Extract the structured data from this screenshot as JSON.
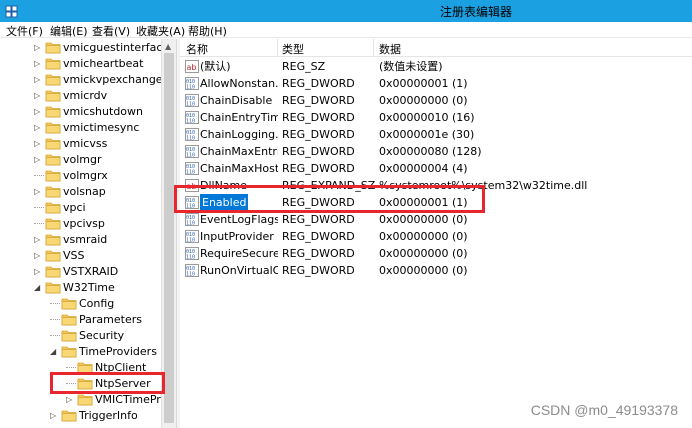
{
  "window": {
    "title": "注册表编辑器",
    "titlebar_color": "#1ba1e2"
  },
  "menu": [
    {
      "label": "文件(F)"
    },
    {
      "label": "编辑(E)"
    },
    {
      "label": "查看(V)"
    },
    {
      "label": "收藏夹(A)"
    },
    {
      "label": "帮助(H)"
    }
  ],
  "tree": {
    "items": [
      {
        "label": "vmicguestinterface",
        "icon": "folder-icon",
        "expander": "collapsed"
      },
      {
        "label": "vmicheartbeat",
        "icon": "folder-icon",
        "expander": "collapsed"
      },
      {
        "label": "vmickvpexchange",
        "icon": "folder-icon",
        "expander": "collapsed"
      },
      {
        "label": "vmicrdv",
        "icon": "folder-icon",
        "expander": "collapsed"
      },
      {
        "label": "vmicshutdown",
        "icon": "folder-icon",
        "expander": "collapsed"
      },
      {
        "label": "vmictimesync",
        "icon": "folder-icon",
        "expander": "collapsed"
      },
      {
        "label": "vmicvss",
        "icon": "folder-icon",
        "expander": "collapsed"
      },
      {
        "label": "volmgr",
        "icon": "folder-icon",
        "expander": "collapsed"
      },
      {
        "label": "volmgrx",
        "icon": "folder-icon",
        "expander": "none"
      },
      {
        "label": "volsnap",
        "icon": "folder-icon",
        "expander": "collapsed"
      },
      {
        "label": "vpci",
        "icon": "folder-icon",
        "expander": "none"
      },
      {
        "label": "vpcivsp",
        "icon": "folder-icon",
        "expander": "none"
      },
      {
        "label": "vsmraid",
        "icon": "folder-icon",
        "expander": "collapsed"
      },
      {
        "label": "VSS",
        "icon": "folder-icon",
        "expander": "collapsed"
      },
      {
        "label": "VSTXRAID",
        "icon": "folder-icon",
        "expander": "collapsed"
      },
      {
        "label": "W32Time",
        "icon": "folder-open-icon",
        "expander": "expanded"
      },
      {
        "label": "Config",
        "icon": "folder-icon",
        "expander": "none"
      },
      {
        "label": "Parameters",
        "icon": "folder-icon",
        "expander": "none"
      },
      {
        "label": "Security",
        "icon": "folder-icon",
        "expander": "none"
      },
      {
        "label": "TimeProviders",
        "icon": "folder-open-icon",
        "expander": "expanded"
      },
      {
        "label": "NtpClient",
        "icon": "folder-icon",
        "expander": "none"
      },
      {
        "label": "NtpServer",
        "icon": "folder-open-icon",
        "expander": "none"
      },
      {
        "label": "VMICTimeProv",
        "icon": "folder-icon",
        "expander": "collapsed"
      },
      {
        "label": "TriggerInfo",
        "icon": "folder-icon",
        "expander": "collapsed"
      }
    ]
  },
  "list": {
    "columns": [
      "名称",
      "类型",
      "数据"
    ],
    "rows": [
      {
        "name": "(默认)",
        "type": "REG_SZ",
        "data": "(数值未设置)",
        "icon": "string-value-icon"
      },
      {
        "name": "AllowNonstan...",
        "type": "REG_DWORD",
        "data": "0x00000001 (1)",
        "icon": "binary-value-icon"
      },
      {
        "name": "ChainDisable",
        "type": "REG_DWORD",
        "data": "0x00000000 (0)",
        "icon": "binary-value-icon"
      },
      {
        "name": "ChainEntryTim...",
        "type": "REG_DWORD",
        "data": "0x00000010 (16)",
        "icon": "binary-value-icon"
      },
      {
        "name": "ChainLogging...",
        "type": "REG_DWORD",
        "data": "0x0000001e (30)",
        "icon": "binary-value-icon"
      },
      {
        "name": "ChainMaxEntries",
        "type": "REG_DWORD",
        "data": "0x00000080 (128)",
        "icon": "binary-value-icon"
      },
      {
        "name": "ChainMaxHost...",
        "type": "REG_DWORD",
        "data": "0x00000004 (4)",
        "icon": "binary-value-icon"
      },
      {
        "name": "DllName",
        "type": "REG_EXPAND_SZ",
        "data": "%systemroot%\\system32\\w32time.dll",
        "icon": "string-value-icon"
      },
      {
        "name": "Enabled",
        "type": "REG_DWORD",
        "data": "0x00000001 (1)",
        "icon": "binary-value-icon",
        "selected": true
      },
      {
        "name": "EventLogFlags",
        "type": "REG_DWORD",
        "data": "0x00000000 (0)",
        "icon": "binary-value-icon"
      },
      {
        "name": "InputProvider",
        "type": "REG_DWORD",
        "data": "0x00000000 (0)",
        "icon": "binary-value-icon"
      },
      {
        "name": "RequireSecure...",
        "type": "REG_DWORD",
        "data": "0x00000000 (0)",
        "icon": "binary-value-icon"
      },
      {
        "name": "RunOnVirtualO...",
        "type": "REG_DWORD",
        "data": "0x00000000 (0)",
        "icon": "binary-value-icon"
      }
    ]
  },
  "watermark": "CSDN @m0_49193378",
  "colors": {
    "highlight_box": "#e8262d",
    "selection": "#0078d7"
  }
}
